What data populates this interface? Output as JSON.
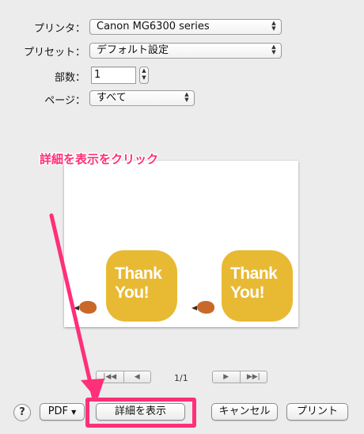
{
  "printer": {
    "label": "プリンタ：",
    "value": "Canon MG6300 series"
  },
  "presets": {
    "label": "プリセット：",
    "value": "デフォルト設定"
  },
  "copies": {
    "label": "部数：",
    "value": "1"
  },
  "pages": {
    "label": "ページ：",
    "value": "すべて"
  },
  "preview": {
    "cards": [
      {
        "text": "Thank\nYou!"
      },
      {
        "text": "Thank\nYou!"
      }
    ],
    "page_indicator": "1/1",
    "card_color": "#e8b933"
  },
  "buttons": {
    "help": "?",
    "pdf": "PDF",
    "show_details": "詳細を表示",
    "cancel": "キャンセル",
    "print": "プリント"
  },
  "annotation": {
    "text": "詳細を表示をクリック",
    "color": "#ff2f79"
  }
}
